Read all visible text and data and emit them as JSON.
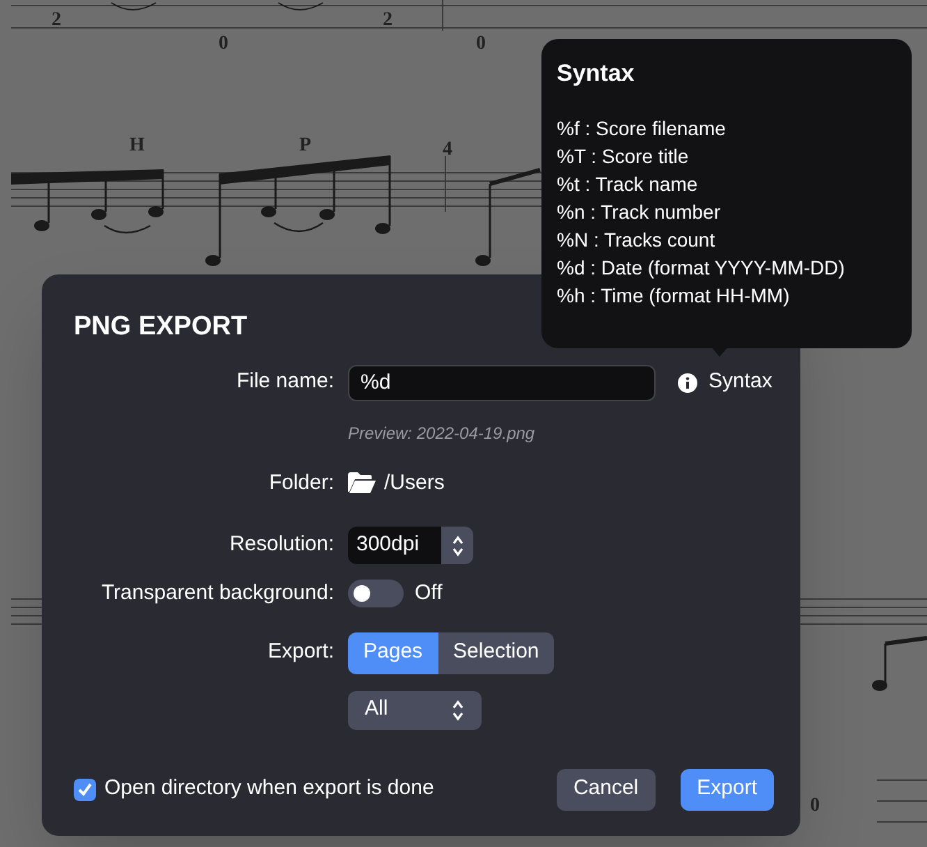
{
  "score": {
    "marks": [
      {
        "text": "2"
      },
      {
        "text": "0"
      },
      {
        "text": "2"
      },
      {
        "text": "0"
      },
      {
        "text": "H"
      },
      {
        "text": "P"
      },
      {
        "text": "4"
      },
      {
        "text": "0"
      }
    ]
  },
  "dialog": {
    "title": "PNG EXPORT",
    "file_name": {
      "label": "File name:",
      "value": "%d"
    },
    "syntax_link": "Syntax",
    "preview": "Preview: 2022-04-19.png",
    "folder": {
      "label": "Folder:",
      "path": "/Users"
    },
    "resolution": {
      "label": "Resolution:",
      "value": "300dpi"
    },
    "transparent": {
      "label": "Transparent background:",
      "on": false,
      "state_text": "Off"
    },
    "export": {
      "label": "Export:",
      "options": [
        {
          "label": "Pages",
          "selected": true
        },
        {
          "label": "Selection",
          "selected": false
        }
      ]
    },
    "pages_select": {
      "value": "All"
    },
    "open_directory": {
      "label": "Open directory when export is done",
      "checked": true
    },
    "buttons": [
      {
        "label": "Cancel",
        "kind": "secondary"
      },
      {
        "label": "Export",
        "kind": "primary"
      }
    ]
  },
  "tooltip": {
    "title": "Syntax",
    "lines": [
      "%f : Score filename",
      "%T : Score title",
      "%t : Track name",
      "%n : Track number",
      "%N : Tracks count",
      "%d : Date (format YYYY-MM-DD)",
      "%h : Time (format HH-MM)"
    ]
  }
}
